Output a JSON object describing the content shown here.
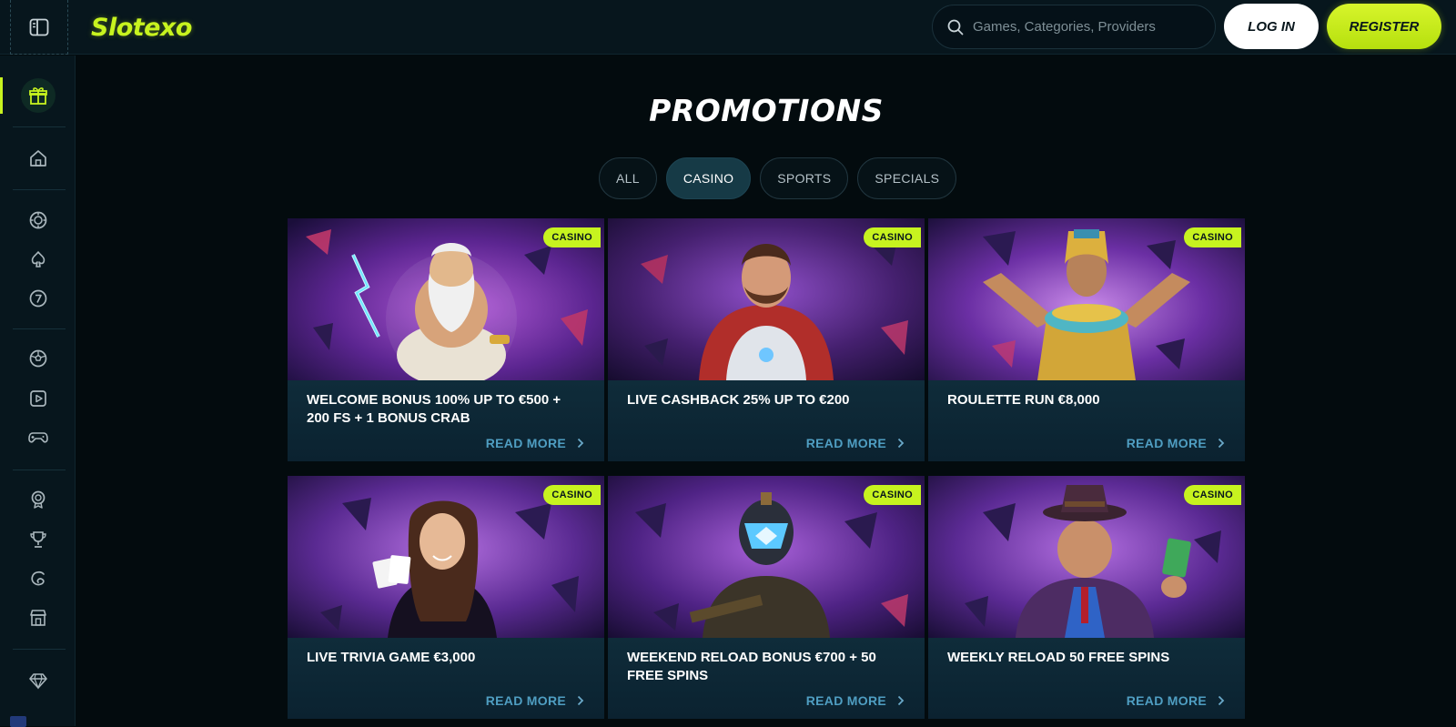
{
  "header": {
    "logo": "Slotexo",
    "search_placeholder": "Games, Categories, Providers",
    "login_label": "LOG IN",
    "register_label": "REGISTER"
  },
  "sidebar": {
    "items": [
      {
        "icon": "promotions-gift-icon",
        "active": true
      },
      {
        "icon": "home-icon"
      },
      {
        "icon": "live-casino-chip-icon"
      },
      {
        "icon": "cards-spade-icon"
      },
      {
        "icon": "slots-seven-icon"
      },
      {
        "icon": "sports-ball-icon"
      },
      {
        "icon": "video-play-icon"
      },
      {
        "icon": "gamepad-icon"
      },
      {
        "icon": "rewards-medal-icon"
      },
      {
        "icon": "trophy-icon"
      },
      {
        "icon": "loyalty-icon"
      },
      {
        "icon": "shop-icon"
      },
      {
        "icon": "vip-diamond-icon"
      }
    ],
    "accent": "#c7f31f"
  },
  "page": {
    "title": "PROMOTIONS",
    "tabs": [
      {
        "label": "ALL",
        "active": false
      },
      {
        "label": "CASINO",
        "active": true
      },
      {
        "label": "SPORTS",
        "active": false
      },
      {
        "label": "SPECIALS",
        "active": false
      }
    ]
  },
  "promotions": [
    {
      "title": "WELCOME BONUS 100% UP TO €500 + 200 FS + 1 BONUS CRAB",
      "badge": "CASINO",
      "cta": "READ MORE",
      "art": "zeus"
    },
    {
      "title": "LIVE CASHBACK 25% UP TO €200",
      "badge": "CASINO",
      "cta": "READ MORE",
      "art": "astronaut"
    },
    {
      "title": "ROULETTE RUN €8,000",
      "badge": "CASINO",
      "cta": "READ MORE",
      "art": "pharaoh"
    },
    {
      "title": "LIVE TRIVIA GAME €3,000",
      "badge": "CASINO",
      "cta": "READ MORE",
      "art": "dealer"
    },
    {
      "title": "WEEKEND RELOAD BONUS €700 + 50 FREE SPINS",
      "badge": "CASINO",
      "cta": "READ MORE",
      "art": "robot"
    },
    {
      "title": "WEEKLY RELOAD 50 FREE SPINS",
      "badge": "CASINO",
      "cta": "READ MORE",
      "art": "gangster"
    }
  ],
  "colors": {
    "accent": "#c7f31f",
    "background": "#030b0e",
    "card": "#0d2633",
    "link": "#4f9ec2"
  }
}
